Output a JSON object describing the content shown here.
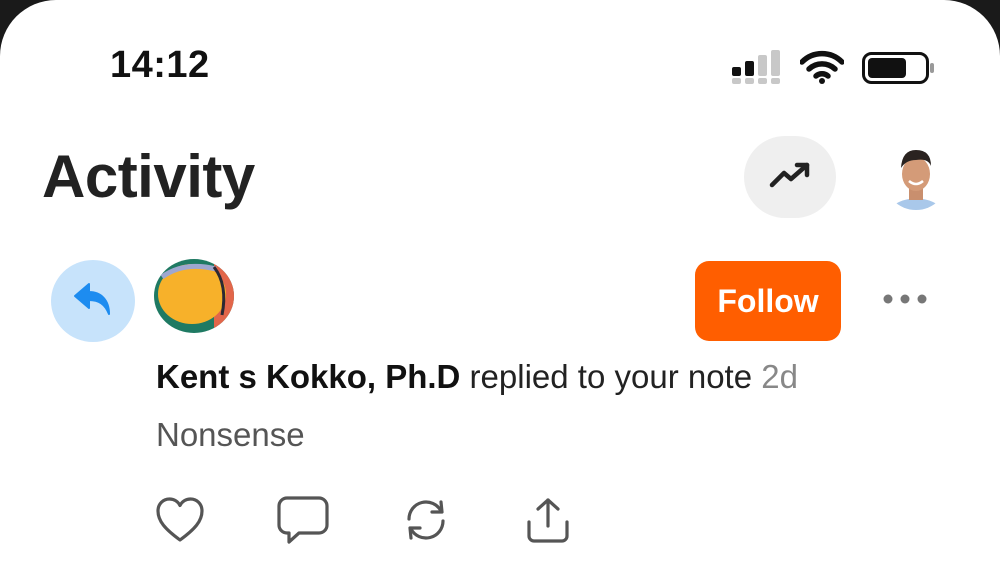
{
  "status_bar": {
    "time": "14:12",
    "signal_icon": "cellular-signal-icon",
    "wifi_icon": "wifi-icon",
    "battery_icon": "battery-icon"
  },
  "header": {
    "title": "Activity",
    "trend_icon": "trending-up-icon",
    "profile_avatar": "profile-avatar"
  },
  "activity": {
    "type_icon": "reply-icon",
    "user_name": "Kent s Kokko, Ph.D",
    "action_text": " replied to your note ",
    "time_ago": "2d",
    "reply_text": "Nonsense",
    "follow_label": "Follow",
    "more_icon": "more-dots-icon"
  },
  "actions": {
    "like_icon": "heart-icon",
    "comment_icon": "comment-icon",
    "restack_icon": "restack-icon",
    "share_icon": "share-icon"
  },
  "colors": {
    "accent": "#ff5e00",
    "reply_badge_bg": "#c7e3fb",
    "reply_icon": "#1d8cf0",
    "trend_btn_bg": "#efefef"
  }
}
